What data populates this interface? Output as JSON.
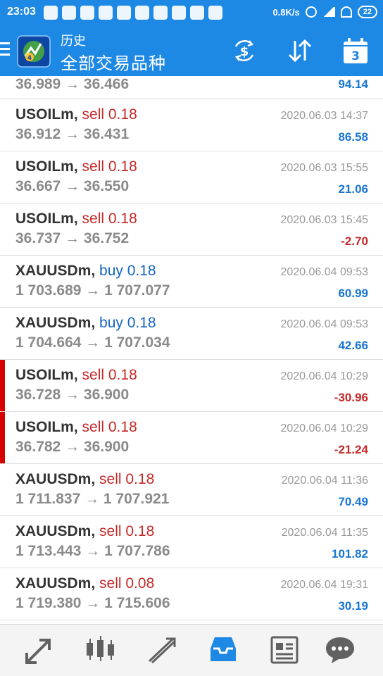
{
  "status_bar": {
    "time": "23:03",
    "net_speed": "0.8K/s",
    "battery": "22"
  },
  "header": {
    "subtitle": "历史",
    "title": "全部交易品种",
    "calendar_day": "3"
  },
  "colors": {
    "header_bg": "#1e88e5",
    "sell": "#c62828",
    "buy": "#1565c0",
    "profit_positive": "#1976d2",
    "profit_negative": "#c62828",
    "marker": "#d50000"
  },
  "trades": [
    {
      "prices": "36.989 → 36.466",
      "profit": "94.14",
      "partial": true
    },
    {
      "symbol": "USOILm,",
      "side": "sell 0.18",
      "prices": "36.912 → 36.431",
      "date": "2020.06.03 14:37",
      "profit": "86.58"
    },
    {
      "symbol": "USOILm,",
      "side": "sell 0.18",
      "prices": "36.667 → 36.550",
      "date": "2020.06.03 15:55",
      "profit": "21.06"
    },
    {
      "symbol": "USOILm,",
      "side": "sell 0.18",
      "prices": "36.737 → 36.752",
      "date": "2020.06.03 15:45",
      "profit": "-2.70"
    },
    {
      "symbol": "XAUUSDm,",
      "side": "buy 0.18",
      "prices": "1 703.689 → 1 707.077",
      "date": "2020.06.04 09:53",
      "profit": "60.99"
    },
    {
      "symbol": "XAUUSDm,",
      "side": "buy 0.18",
      "prices": "1 704.664 → 1 707.034",
      "date": "2020.06.04 09:53",
      "profit": "42.66"
    },
    {
      "symbol": "USOILm,",
      "side": "sell 0.18",
      "prices": "36.728 → 36.900",
      "date": "2020.06.04 10:29",
      "profit": "-30.96",
      "marked": true
    },
    {
      "symbol": "USOILm,",
      "side": "sell 0.18",
      "prices": "36.782 → 36.900",
      "date": "2020.06.04 10:29",
      "profit": "-21.24",
      "marked": true
    },
    {
      "symbol": "XAUUSDm,",
      "side": "sell 0.18",
      "prices": "1 711.837 → 1 707.921",
      "date": "2020.06.04 11:36",
      "profit": "70.49"
    },
    {
      "symbol": "XAUUSDm,",
      "side": "sell 0.18",
      "prices": "1 713.443 → 1 707.786",
      "date": "2020.06.04 11:35",
      "profit": "101.82"
    },
    {
      "symbol": "XAUUSDm,",
      "side": "sell 0.08",
      "prices": "1 719.380 → 1 715.606",
      "date": "2020.06.04 19:31",
      "profit": "30.19"
    }
  ],
  "bottom_nav": [
    {
      "icon": "quotes-icon"
    },
    {
      "icon": "chart-icon"
    },
    {
      "icon": "trade-icon"
    },
    {
      "icon": "history-icon",
      "active": true
    },
    {
      "icon": "news-icon"
    },
    {
      "icon": "chat-icon"
    }
  ]
}
